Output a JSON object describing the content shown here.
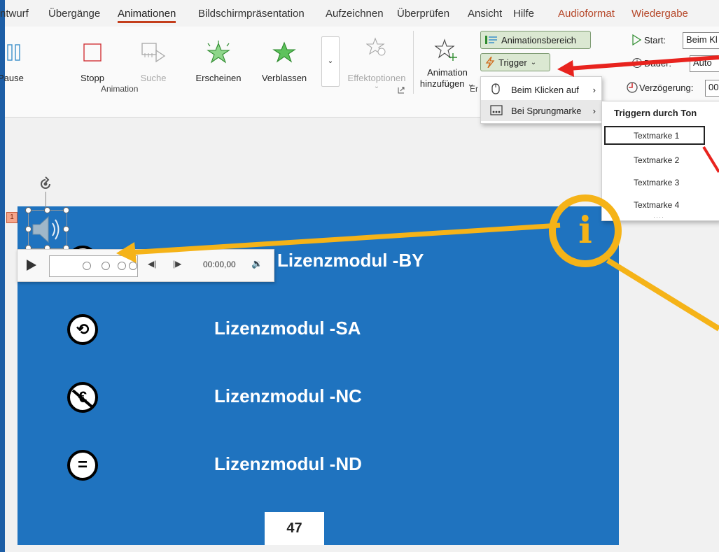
{
  "tabs": [
    {
      "label": "ntwurf",
      "active": false
    },
    {
      "label": "Übergänge",
      "active": false
    },
    {
      "label": "Animationen",
      "active": true
    },
    {
      "label": "Bildschirmpräsentation",
      "active": false
    },
    {
      "label": "Aufzeichnen",
      "active": false
    },
    {
      "label": "Überprüfen",
      "active": false
    },
    {
      "label": "Ansicht",
      "active": false
    },
    {
      "label": "Hilfe",
      "active": false
    },
    {
      "label": "Audioformat",
      "active": false,
      "contextual": true
    },
    {
      "label": "Wiedergabe",
      "active": false,
      "contextual": true
    }
  ],
  "ribbon": {
    "animation_group": {
      "label": "Animation",
      "buttons": [
        {
          "label": "Pause",
          "icon": "pause-icon"
        },
        {
          "label": "Stopp",
          "icon": "stop-icon"
        },
        {
          "label": "Suche",
          "icon": "seek-icon",
          "disabled": true
        },
        {
          "label": "Erscheinen",
          "icon": "appear-star-icon"
        },
        {
          "label": "Verblassen",
          "icon": "fade-star-icon"
        }
      ],
      "effect_options_label": "Effektoptionen"
    },
    "add_animation_label": "Animation\nhinzufügen",
    "add_animation_line1": "Animation",
    "add_animation_line2": "hinzufügen",
    "erweitert_partial": "Er",
    "animation_pane_label": "Animationsbereich",
    "trigger_label": "Trigger",
    "timing": {
      "start_label": "Start:",
      "start_value": "Beim Kl",
      "duration_label": "Dauer:",
      "duration_value": "Auto",
      "delay_label": "Verzögerung:",
      "delay_value": "00"
    }
  },
  "trigger_menu": {
    "items": [
      {
        "label": "Beim Klicken auf",
        "icon": "mouse-icon"
      },
      {
        "label": "Bei Sprungmarke",
        "icon": "bookmark-icon"
      }
    ]
  },
  "bookmark_menu": {
    "header": "Triggern durch Ton",
    "items": [
      "Textmarke 1",
      "Textmarke 2",
      "Textmarke 3",
      "Textmarke 4"
    ],
    "selected_index": 0
  },
  "slide": {
    "animation_tag": "1",
    "licenses": [
      {
        "text": "Lizenzmodul -BY",
        "icon": "cc-by-icon",
        "glyph": ""
      },
      {
        "text": "Lizenzmodul -SA",
        "icon": "cc-sa-icon",
        "glyph": "⟲"
      },
      {
        "text": "Lizenzmodul -NC",
        "icon": "cc-nc-icon",
        "glyph": "€"
      },
      {
        "text": "Lizenzmodul -ND",
        "icon": "cc-nd-icon",
        "glyph": "="
      }
    ],
    "page_number": "47"
  },
  "player": {
    "time": "00:00,00"
  },
  "callout_letter": "i",
  "colors": {
    "accent_red": "#c43e1c",
    "arrow_red": "#e8231e",
    "arrow_yellow": "#f5b318",
    "slide_blue": "#1f73bf",
    "frame_blue": "#1d5ea6"
  }
}
